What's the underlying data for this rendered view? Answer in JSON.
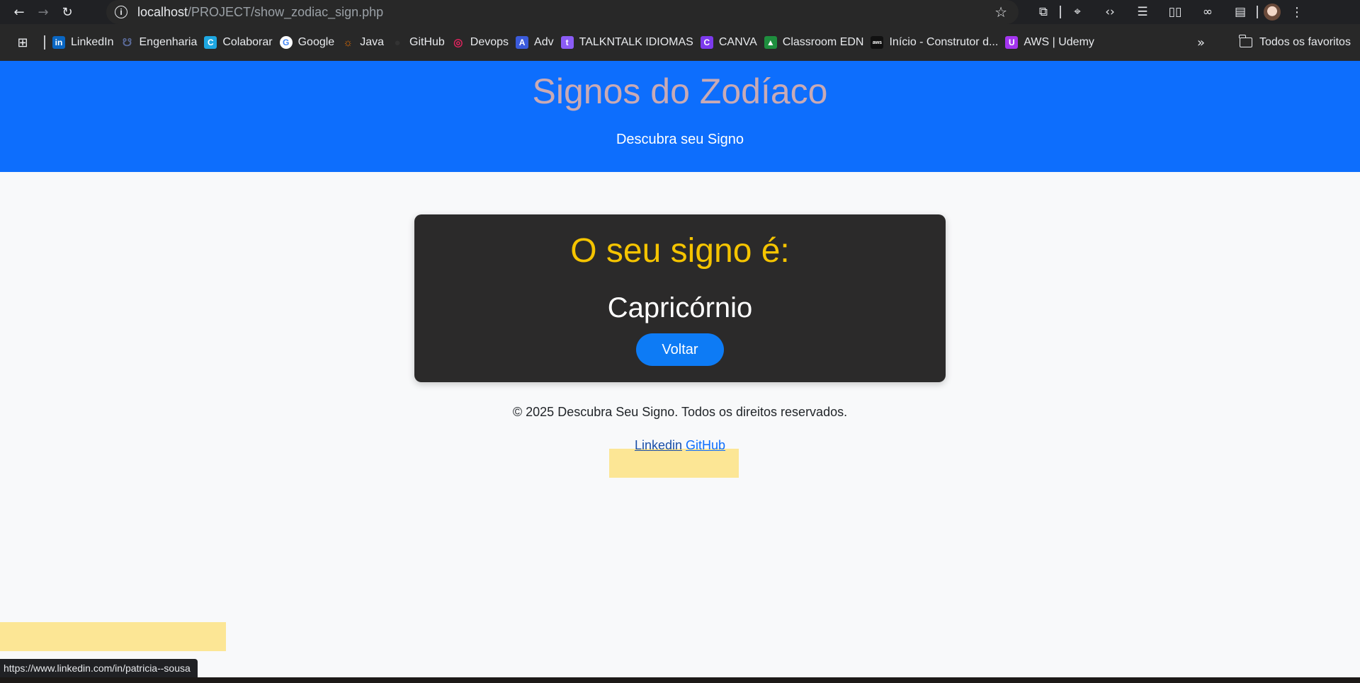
{
  "browser": {
    "url_host": "localhost",
    "url_path": "/PROJECT/show_zodiac_sign.php",
    "bookmarks": [
      {
        "label": "LinkedIn",
        "icon": "linkedin-icon",
        "color": "#0a66c2",
        "glyph": "in"
      },
      {
        "label": "Engenharia",
        "icon": "engenharia-icon",
        "color": "#5b6b9a",
        "glyph": "☋"
      },
      {
        "label": "Colaborar",
        "icon": "colaborar-icon",
        "color": "#1ea7e1",
        "glyph": "C"
      },
      {
        "label": "Google",
        "icon": "google-icon",
        "color": "#ffffff",
        "glyph": "G"
      },
      {
        "label": "Java",
        "icon": "java-icon",
        "color": "#e76f00",
        "glyph": "☼"
      },
      {
        "label": "GitHub",
        "icon": "github-icon",
        "color": "#333333",
        "glyph": "●"
      },
      {
        "label": "Devops",
        "icon": "devops-icon",
        "color": "#e0245e",
        "glyph": "◎"
      },
      {
        "label": "Adv",
        "icon": "adv-icon",
        "color": "#3b5bdb",
        "glyph": "A"
      },
      {
        "label": "TALKNTALK IDIOMAS",
        "icon": "talkntalk-icon",
        "color": "#8b5cf6",
        "glyph": "t"
      },
      {
        "label": "CANVA",
        "icon": "canva-icon",
        "color": "#7c3aed",
        "glyph": "C"
      },
      {
        "label": "Classroom EDN",
        "icon": "classroom-icon",
        "color": "#1e8e3e",
        "glyph": "▲"
      },
      {
        "label": "Início - Construtor d...",
        "icon": "aws-icon",
        "color": "#111111",
        "glyph": "aws"
      },
      {
        "label": "AWS | Udemy",
        "icon": "udemy-icon",
        "color": "#a435f0",
        "glyph": "U"
      }
    ],
    "all_bookmarks_label": "Todos os favoritos",
    "status_url": "https://www.linkedin.com/in/patricia--sousa"
  },
  "header": {
    "title": "Signos do Zodíaco",
    "subtitle": "Descubra seu Signo"
  },
  "result": {
    "heading": "O seu signo é:",
    "sign": "Capricórnio",
    "back_label": "Voltar"
  },
  "footer": {
    "copyright": "© 2025 Descubra Seu Signo. Todos os direitos reservados.",
    "linkedin_label": "Linkedin",
    "github_label": "GitHub"
  },
  "colors": {
    "header_bg": "#0d6efd",
    "title_color": "#c9aab5",
    "card_bg": "#2b2a2a",
    "card_heading": "#f5c400",
    "button_bg": "#0d7bf5",
    "highlight": "#fce695"
  }
}
